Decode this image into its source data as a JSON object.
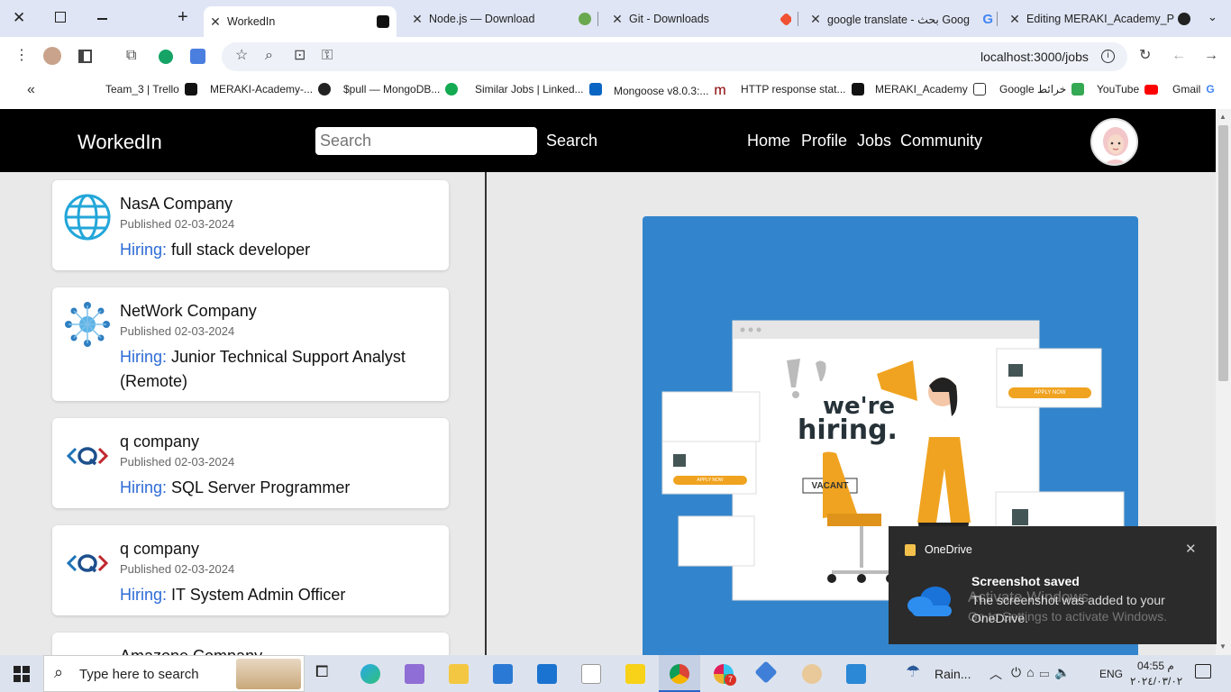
{
  "browser": {
    "tabs": [
      {
        "label": "WorkedIn",
        "active": true
      },
      {
        "label": "Node.js — Download"
      },
      {
        "label": "Git - Downloads"
      },
      {
        "label": "google translate - بحث Goog"
      },
      {
        "label": "Editing MERAKI_Academy_P"
      }
    ],
    "url": "localhost:3000/jobs",
    "bookmarks": [
      "Team_3 | Trello",
      "MERAKI-Academy-...",
      "$pull — MongoDB...",
      "Similar Jobs | Linked...",
      "Mongoose v8.0.3:...",
      "HTTP response stat...",
      "MERAKI_Academy",
      "Google خرائط",
      "YouTube",
      "Gmail"
    ]
  },
  "app": {
    "brand": "WorkedIn",
    "search_placeholder": "Search",
    "search_button": "Search",
    "nav": [
      "Home",
      "Profile",
      "Jobs",
      "Community"
    ]
  },
  "jobs": [
    {
      "company": "NasA Company",
      "published": "Published 02-03-2024",
      "hiring_label": "Hiring:",
      "title": "full stack developer"
    },
    {
      "company": "NetWork Company",
      "published": "Published 02-03-2024",
      "hiring_label": "Hiring:",
      "title": "Junior Technical Support Analyst (Remote)"
    },
    {
      "company": "q company",
      "published": "Published 02-03-2024",
      "hiring_label": "Hiring:",
      "title": "SQL Server Programmer"
    },
    {
      "company": "q company",
      "published": "Published 02-03-2024",
      "hiring_label": "Hiring:",
      "title": "IT System Admin Officer"
    },
    {
      "company": "Amazone Company"
    }
  ],
  "illustration": {
    "headline_1": "we're",
    "headline_2": "hiring.",
    "apply_now": "APPLY NOW",
    "vacant": "VACANT"
  },
  "toast": {
    "app": "OneDrive",
    "title": "Screenshot saved",
    "body": "The screenshot was added to your OneDrive.",
    "watermark_1": "Activate Windows",
    "watermark_2": "Go to Settings to activate Windows."
  },
  "taskbar": {
    "search_placeholder": "Type here to search",
    "weather": "Rain...",
    "lang": "ENG",
    "time": "04:55 م",
    "date": "٢٠٢٤/٠٣/٠٢",
    "chrome_badge": "7"
  },
  "colors": {
    "accent": "#2d6bd6",
    "navbar": "#000000",
    "illustration_bg": "#3285cc"
  }
}
